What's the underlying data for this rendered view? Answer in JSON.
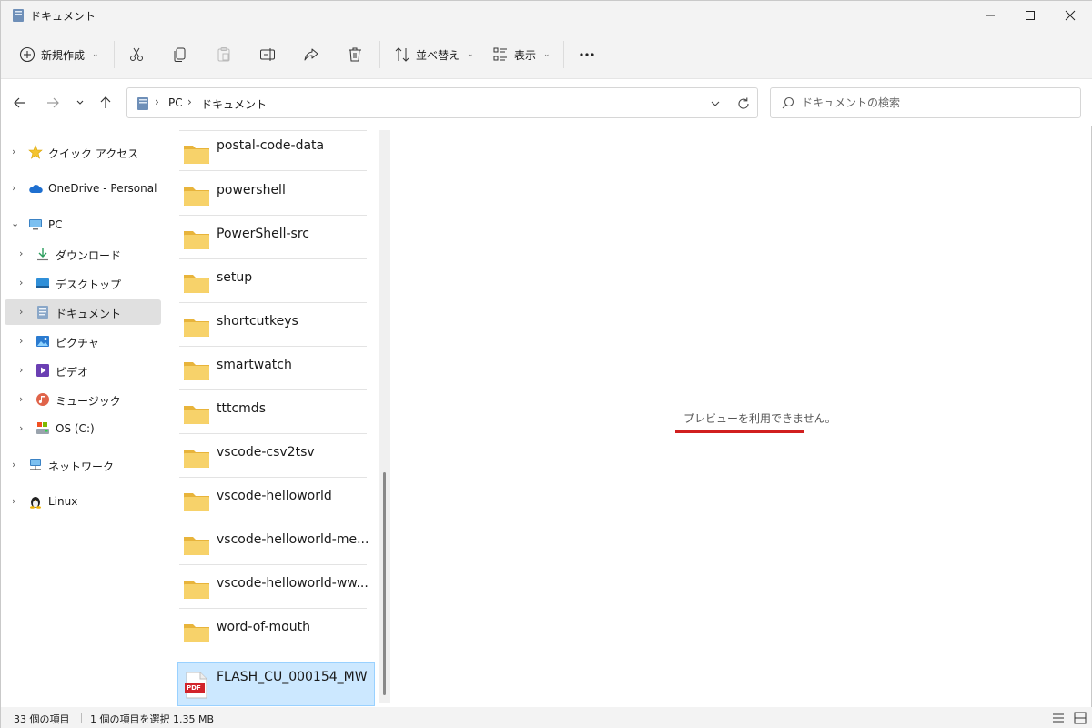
{
  "window": {
    "title": "ドキュメント",
    "controls": {
      "minimize": "minimize",
      "maximize": "maximize",
      "close": "close"
    }
  },
  "toolbar": {
    "new_label": "新規作成",
    "sort_label": "並べ替え",
    "view_label": "表示",
    "icons": [
      "cut-icon",
      "copy-icon",
      "paste-icon",
      "rename-icon",
      "share-icon",
      "delete-icon",
      "more-icon"
    ]
  },
  "address": {
    "crumbs": [
      "PC",
      "ドキュメント"
    ]
  },
  "search": {
    "placeholder": "ドキュメントの検索"
  },
  "sidebar": {
    "items": [
      {
        "label": "クイック アクセス",
        "icon": "star-icon",
        "expand": "collapsed"
      },
      {
        "label": "OneDrive - Personal",
        "icon": "cloud-icon",
        "expand": "collapsed"
      },
      {
        "label": "PC",
        "icon": "computer-icon",
        "expand": "expanded"
      },
      {
        "label": "ダウンロード",
        "icon": "download-icon",
        "expand": "collapsed"
      },
      {
        "label": "デスクトップ",
        "icon": "desktop-icon",
        "expand": "collapsed"
      },
      {
        "label": "ドキュメント",
        "icon": "documents-icon",
        "expand": "collapsed",
        "selected": true
      },
      {
        "label": "ピクチャ",
        "icon": "pictures-icon",
        "expand": "collapsed"
      },
      {
        "label": "ビデオ",
        "icon": "video-icon",
        "expand": "collapsed"
      },
      {
        "label": "ミュージック",
        "icon": "music-icon",
        "expand": "collapsed"
      },
      {
        "label": "OS (C:)",
        "icon": "drive-icon",
        "expand": "collapsed"
      },
      {
        "label": "ネットワーク",
        "icon": "network-icon",
        "expand": "collapsed"
      },
      {
        "label": "Linux",
        "icon": "linux-icon",
        "expand": "collapsed"
      }
    ]
  },
  "files": {
    "items": [
      {
        "name": "postal-code-data",
        "type": "folder"
      },
      {
        "name": "powershell",
        "type": "folder"
      },
      {
        "name": "PowerShell-src",
        "type": "folder"
      },
      {
        "name": "setup",
        "type": "folder"
      },
      {
        "name": "shortcutkeys",
        "type": "folder"
      },
      {
        "name": "smartwatch",
        "type": "folder"
      },
      {
        "name": "tttcmds",
        "type": "folder"
      },
      {
        "name": "vscode-csv2tsv",
        "type": "folder"
      },
      {
        "name": "vscode-helloworld",
        "type": "folder"
      },
      {
        "name": "vscode-helloworld-me...",
        "type": "folder"
      },
      {
        "name": "vscode-helloworld-ww...",
        "type": "folder"
      },
      {
        "name": "word-of-mouth",
        "type": "folder"
      },
      {
        "name": "FLASH_CU_000154_MW",
        "type": "pdf",
        "selected": true
      }
    ],
    "pdf_badge": "PDF"
  },
  "preview": {
    "message": "プレビューを利用できません。"
  },
  "status": {
    "item_count": "33 個の項目",
    "selection": "1 個の項目を選択  1.35 MB"
  },
  "colors": {
    "accent_selection": "#cce8ff",
    "folder": "#f7c948",
    "underline": "#d11f1f"
  }
}
